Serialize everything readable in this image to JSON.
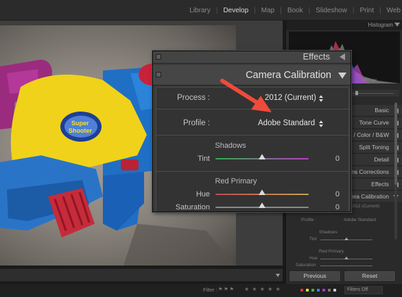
{
  "top_nav": {
    "modules": [
      "Library",
      "Develop",
      "Map",
      "Book",
      "Slideshow",
      "Print",
      "Web"
    ],
    "active": "Develop"
  },
  "right_panel": {
    "histogram_label": "Histogram",
    "hist_readout": "1/50 sec",
    "panels": [
      "Basic",
      "Tone Curve",
      "HSL / Color / B&W",
      "Split Toning",
      "Detail",
      "Lens Corrections",
      "Effects",
      "Camera Calibration"
    ],
    "ghost": {
      "process_value": "2012 (Current)",
      "profile_label": "Profile :",
      "profile_value": "Adobe Standard",
      "shadows": "Shadows",
      "tint": "Tint",
      "red_primary": "Red Primary",
      "hue": "Hue",
      "saturation": "Saturation"
    },
    "previous_label": "Previous",
    "reset_label": "Reset"
  },
  "filmstrip": {
    "filter_label": "Filter :",
    "filters_off": "Filters Off",
    "stars": "★ ★ ★ ★ ★",
    "swatch_colors": [
      "#d33",
      "#dd3",
      "#3b3",
      "#38d",
      "#a3c",
      "#777",
      "#ccc"
    ]
  },
  "popup": {
    "effects_label": "Effects",
    "title": "Camera Calibration",
    "process_label": "Process :",
    "process_value": "2012 (Current)",
    "profile_label": "Profile :",
    "profile_value": "Adobe Standard",
    "shadows_title": "Shadows",
    "tint_label": "Tint",
    "tint_value": "0",
    "red_primary_title": "Red Primary",
    "hue_label": "Hue",
    "hue_value": "0",
    "saturation_label": "Saturation",
    "saturation_value": "0",
    "slider_levels": {
      "tint": 0.5,
      "hue": 0.5,
      "saturation": 0.5
    }
  },
  "colors": {
    "annotation_arrow": "#ee4b3b",
    "tint_track_left": "#2fae4a",
    "tint_track_right": "#b743c6",
    "hue_track_left": "#c04a58",
    "hue_track_right": "#c8a44c"
  }
}
